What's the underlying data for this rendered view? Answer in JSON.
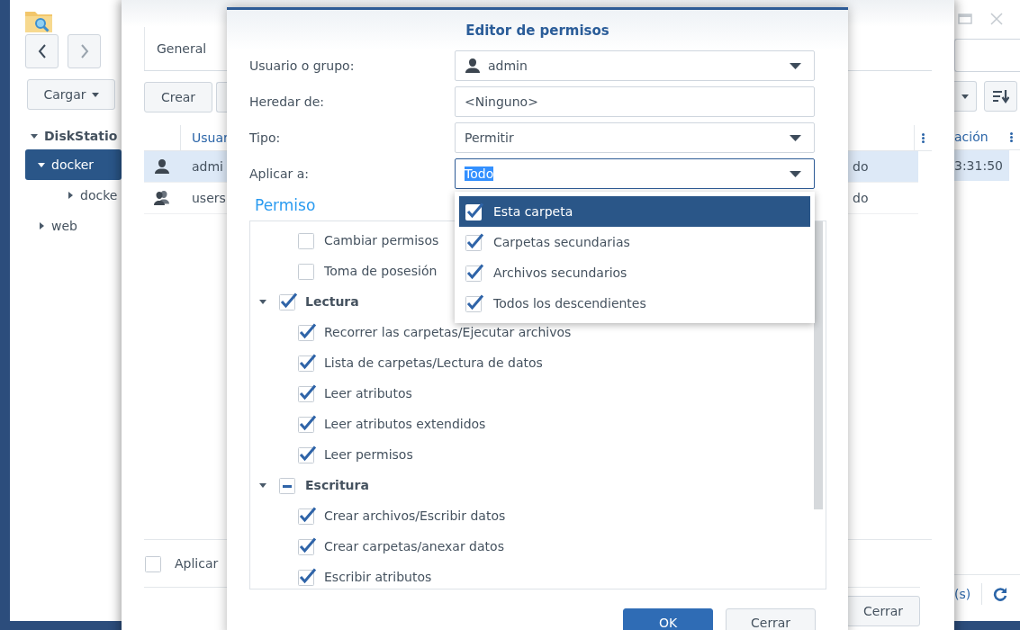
{
  "file_station": {
    "upload_button": "Cargar",
    "tree": [
      {
        "label": "DiskStatio",
        "expanded": true,
        "selected": false,
        "children": [
          {
            "label": "docker",
            "expanded": true,
            "selected": true,
            "children": [
              {
                "label": "docke",
                "expanded": false,
                "selected": false
              }
            ]
          },
          {
            "label": "web",
            "expanded": false,
            "selected": false
          }
        ]
      }
    ],
    "column_header": "ación",
    "rows": [
      {
        "cell": "3:31:50",
        "selected": true
      }
    ],
    "footer_text": "(s)"
  },
  "properties": {
    "tabs": [
      "General"
    ],
    "create_button": "Crear",
    "table": {
      "columns": [
        "Usuar"
      ],
      "rows": [
        {
          "kind": "user",
          "name": "admi",
          "column_3": "do",
          "selected": true
        },
        {
          "kind": "group",
          "name": "users",
          "column_3": "do",
          "selected": false
        }
      ]
    },
    "apply_checkbox": {
      "label": "Aplicar",
      "checked": false
    },
    "close_button": "Cerrar"
  },
  "dialog": {
    "title": "Editor de permisos",
    "fields": [
      {
        "label": "Usuario o grupo:",
        "kind": "user-select",
        "value": "admin",
        "focused": false
      },
      {
        "label": "Heredar de:",
        "kind": "text",
        "value": "<Ninguno>",
        "focused": false
      },
      {
        "label": "Tipo:",
        "kind": "select",
        "value": "Permitir",
        "focused": false
      },
      {
        "label": "Aplicar a:",
        "kind": "select",
        "value": "Todo",
        "focused": true
      }
    ],
    "permission_heading": "Permiso",
    "permissions": [
      {
        "children": [
          {
            "label": "Cambiar permisos",
            "checked": false
          },
          {
            "label": "Toma de posesión",
            "checked": false
          }
        ]
      },
      {
        "label": "Lectura",
        "expanded": true,
        "checked": true,
        "partial": false,
        "children": [
          {
            "label": "Recorrer las carpetas/Ejecutar archivos",
            "checked": true
          },
          {
            "label": "Lista de carpetas/Lectura de datos",
            "checked": true
          },
          {
            "label": "Leer atributos",
            "checked": true
          },
          {
            "label": "Leer atributos extendidos",
            "checked": true
          },
          {
            "label": "Leer permisos",
            "checked": true
          }
        ]
      },
      {
        "label": "Escritura",
        "expanded": true,
        "checked": false,
        "partial": true,
        "children": [
          {
            "label": "Crear archivos/Escribir datos",
            "checked": true
          },
          {
            "label": "Crear carpetas/anexar datos",
            "checked": true
          },
          {
            "label": "Escribir atributos",
            "checked": true
          }
        ]
      }
    ],
    "apply_menu": [
      {
        "label": "Esta carpeta",
        "checked": true,
        "selected": true
      },
      {
        "label": "Carpetas secundarias",
        "checked": true,
        "selected": false
      },
      {
        "label": "Archivos secundarios",
        "checked": true,
        "selected": false
      },
      {
        "label": "Todos los descendientes",
        "checked": true,
        "selected": false
      }
    ],
    "buttons": [
      {
        "label": "OK",
        "kind": "primary"
      },
      {
        "label": "Cerrar",
        "kind": "secondary"
      }
    ]
  }
}
